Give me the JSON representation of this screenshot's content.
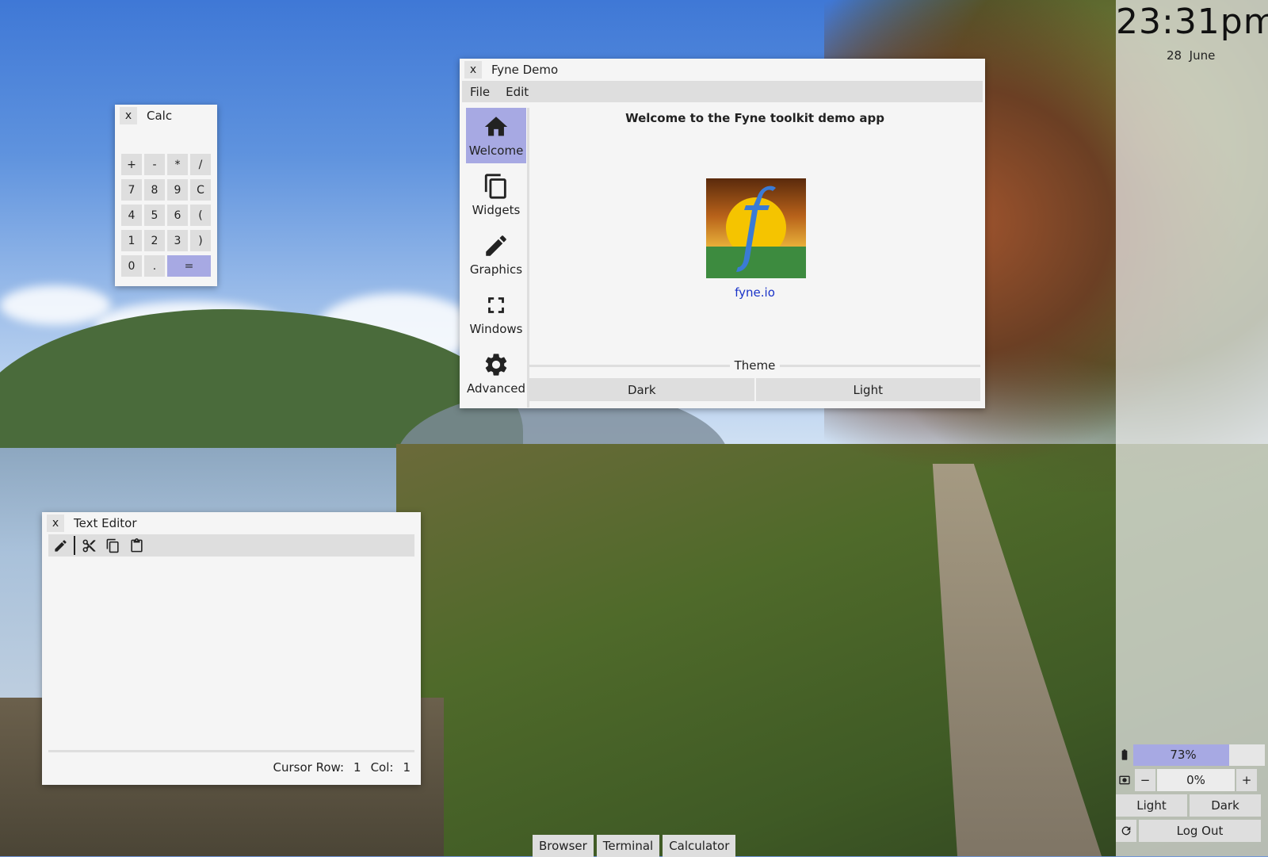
{
  "calc": {
    "title": "Calc",
    "close": "x",
    "buttons": [
      "+",
      "-",
      "*",
      "/",
      "7",
      "8",
      "9",
      "C",
      "4",
      "5",
      "6",
      "(",
      "1",
      "2",
      "3",
      ")",
      "0",
      ".",
      "="
    ]
  },
  "fyne": {
    "title": "Fyne Demo",
    "close": "x",
    "menu": [
      "File",
      "Edit"
    ],
    "nav": [
      "Welcome",
      "Widgets",
      "Graphics",
      "Windows",
      "Advanced"
    ],
    "welcome": "Welcome to the Fyne toolkit demo app",
    "link": "fyne.io",
    "theme_label": "Theme",
    "theme_buttons": [
      "Dark",
      "Light"
    ],
    "accent": "#a7a9e3"
  },
  "editor": {
    "title": "Text Editor",
    "close": "x",
    "status_row_label": "Cursor Row:",
    "status_row": "1",
    "status_col_label": "Col:",
    "status_col": "1",
    "tools": [
      "pencil-icon",
      "cut-icon",
      "copy-icon",
      "paste-icon"
    ]
  },
  "taskbar": [
    "Browser",
    "Terminal",
    "Calculator"
  ],
  "panel": {
    "clock": "23:31pm",
    "date_day": "28",
    "date_month": "June",
    "battery": "73%",
    "battery_level": 0.73,
    "brightness": "0%",
    "brightness_minus": "−",
    "brightness_plus": "+",
    "theme_light": "Light",
    "theme_dark": "Dark",
    "logout": "Log Out"
  }
}
